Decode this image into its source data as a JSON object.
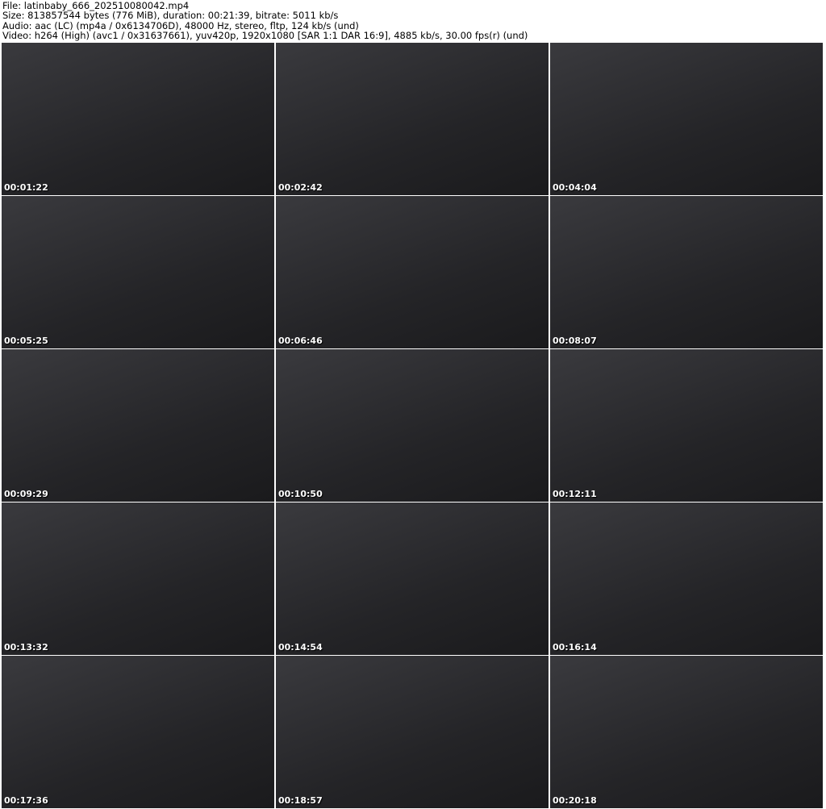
{
  "header": {
    "file": "File: latinbaby_666_202510080042.mp4",
    "size": "Size: 813857544 bytes (776 MiB), duration: 00:21:39, bitrate: 5011 kb/s",
    "audio": "Audio: aac (LC) (mp4a / 0x6134706D), 48000 Hz, stereo, fltp, 124 kb/s (und)",
    "video": "Video: h264 (High) (avc1 / 0x31637661), yuv420p, 1920x1080 [SAR 1:1 DAR 16:9], 4885 kb/s, 30.00 fps(r) (und)"
  },
  "thumbnails": [
    "00:01:22",
    "00:02:42",
    "00:04:04",
    "00:05:25",
    "00:06:46",
    "00:08:07",
    "00:09:29",
    "00:10:50",
    "00:12:11",
    "00:13:32",
    "00:14:54",
    "00:16:14",
    "00:17:36",
    "00:18:57",
    "00:20:18"
  ]
}
